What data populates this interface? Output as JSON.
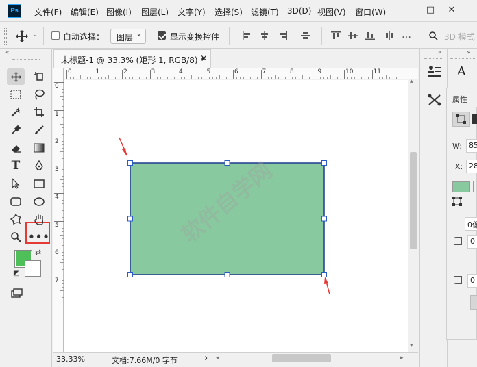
{
  "menubar": {
    "logo": "Ps",
    "items": [
      "文件(F)",
      "编辑(E)",
      "图像(I)",
      "图层(L)",
      "文字(Y)",
      "选择(S)",
      "滤镜(T)",
      "3D(D)",
      "视图(V)",
      "窗口(W)"
    ],
    "window_controls": [
      "—",
      "□",
      "✕"
    ]
  },
  "options": {
    "auto_select_label": "自动选择：",
    "auto_select_checked": false,
    "layer_select_value": "图层",
    "show_transform_label": "显示变换控件",
    "show_transform_checked": true,
    "mode_3d_label": "3D 模式"
  },
  "document": {
    "tab_title": "未标题-1 @ 33.3% (矩形 1, RGB/8) *",
    "tab_close": "×",
    "ruler_top_labels": [
      "0",
      "1",
      "2",
      "3",
      "4",
      "5",
      "6",
      "7",
      "8",
      "9",
      "10",
      "11"
    ],
    "ruler_left_labels": [
      "0",
      "1",
      "2",
      "3",
      "4",
      "5",
      "6",
      "7"
    ],
    "shape_fill": "#88c99f",
    "shape_stroke": "#1f3a8f"
  },
  "status": {
    "zoom": "33.33%",
    "doc_info": "文档:7.66M/0 字节",
    "arrow": "›"
  },
  "properties": {
    "tab_label": "属性",
    "w_label": "W:",
    "w_value": "85",
    "x_label": "X:",
    "x_value": "28",
    "fill_color": "#88c99f",
    "radius_value": "0像",
    "corner1_value": "0",
    "corner2_value": "0"
  },
  "watermark": "软件自学网",
  "colors": {
    "foreground": "#4fbf5a",
    "background": "#ffffff",
    "highlight": "#e53935",
    "arrow": "#e53935"
  }
}
